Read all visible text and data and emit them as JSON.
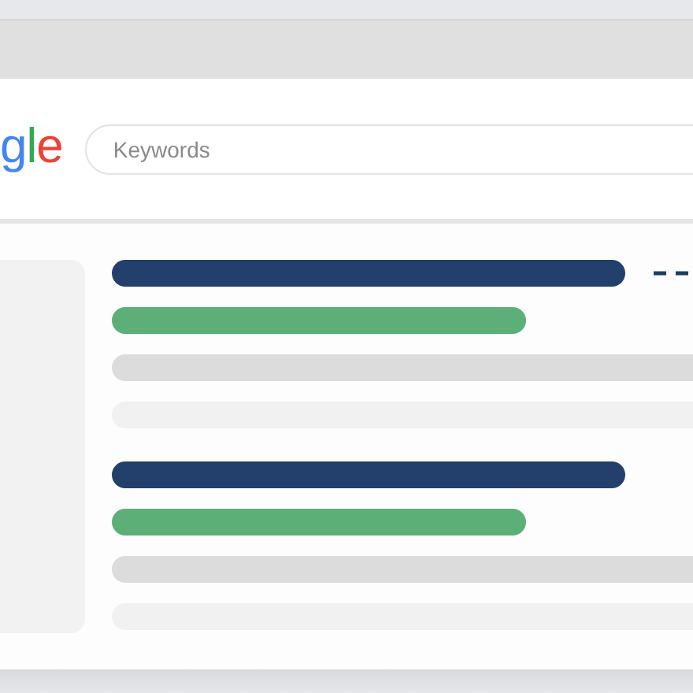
{
  "logo": {
    "letters": [
      {
        "text": "g",
        "color": "#4285f4"
      },
      {
        "text": "l",
        "color": "#34a853"
      },
      {
        "text": "e",
        "color": "#ea4335"
      }
    ]
  },
  "search": {
    "placeholder": "Keywords"
  },
  "results": [
    {
      "pointer": true,
      "lines": [
        {
          "kind": "title"
        },
        {
          "kind": "url"
        },
        {
          "kind": "snippet"
        },
        {
          "kind": "faint"
        }
      ]
    },
    {
      "pointer": false,
      "lines": [
        {
          "kind": "title"
        },
        {
          "kind": "url"
        },
        {
          "kind": "snippet"
        },
        {
          "kind": "faint"
        }
      ]
    }
  ]
}
